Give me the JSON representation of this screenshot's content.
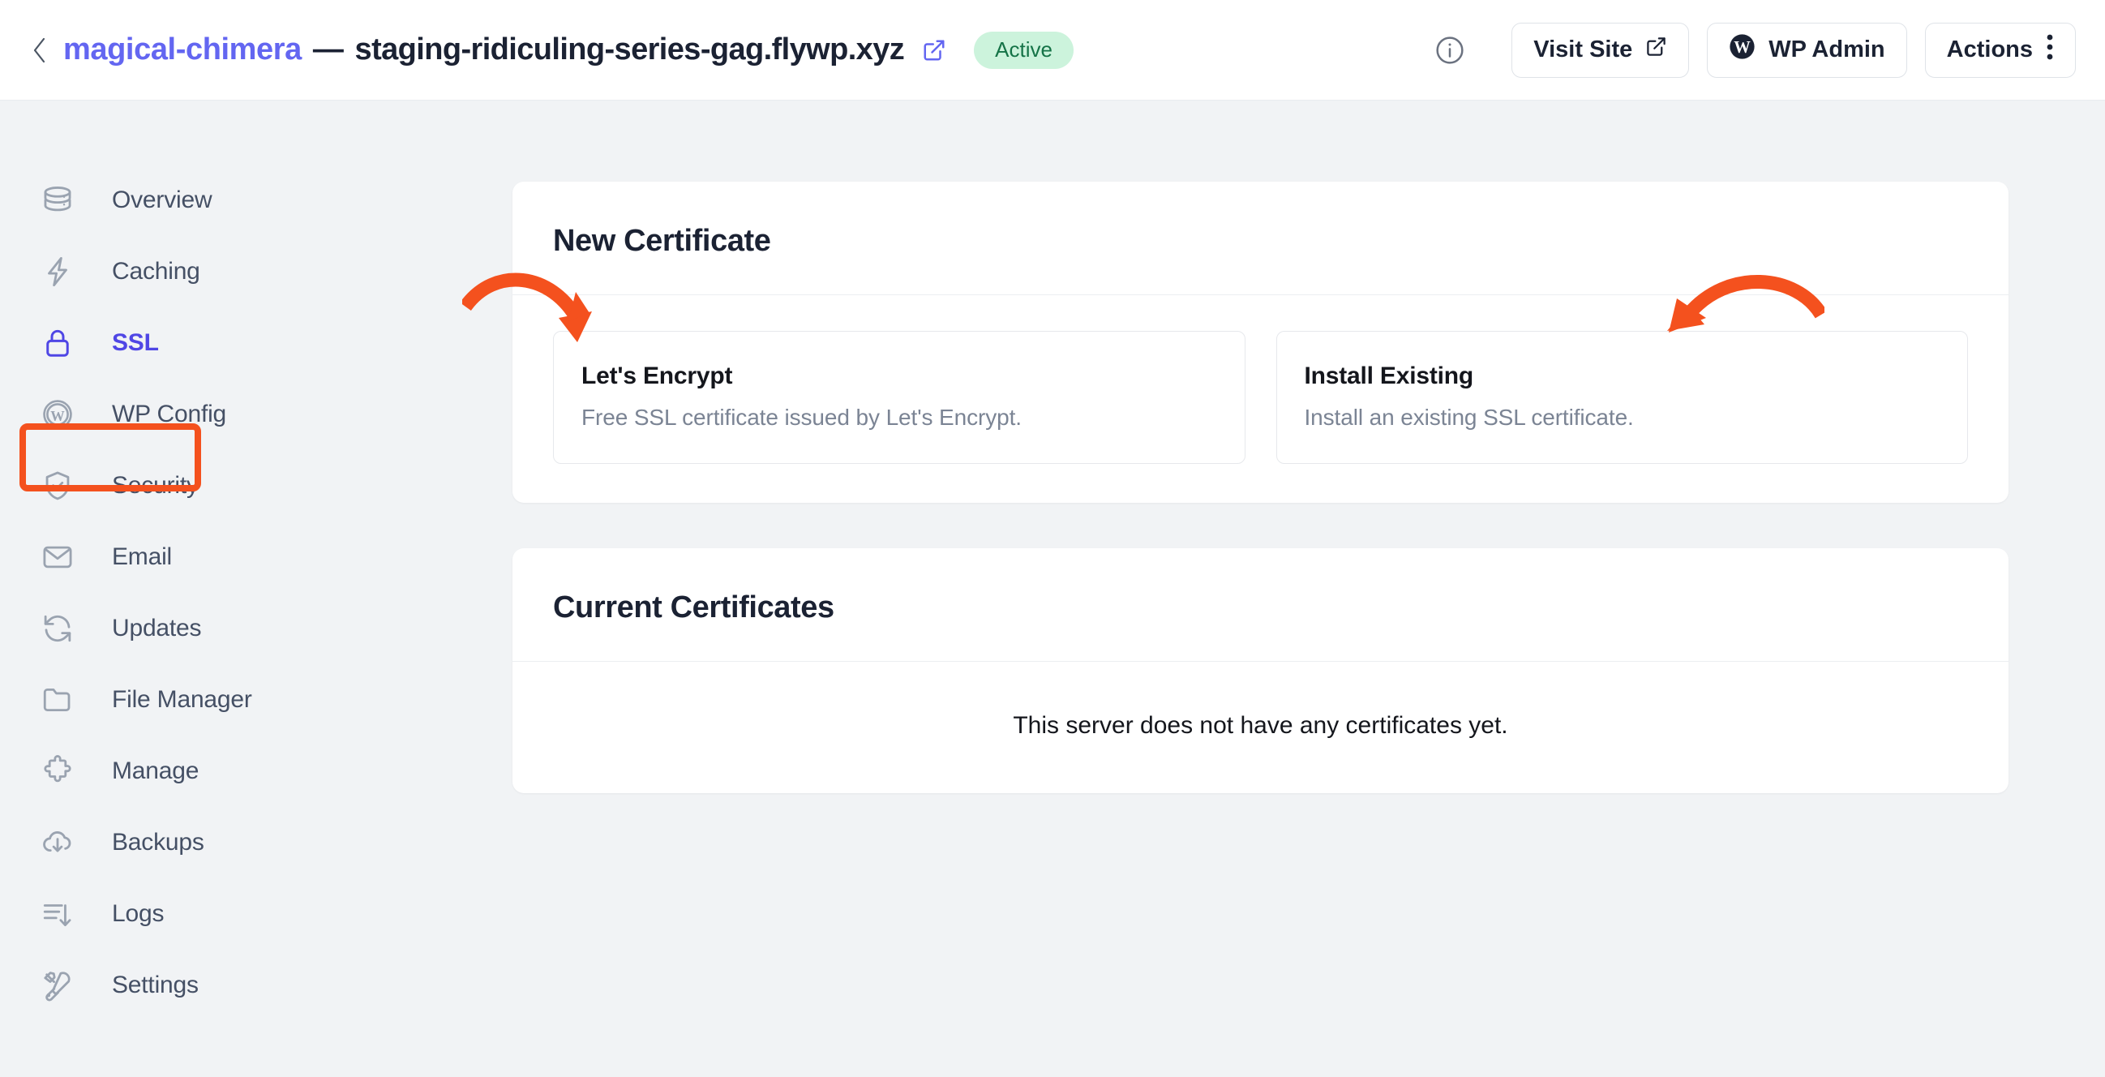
{
  "header": {
    "back_icon": "chevron-left-icon",
    "site_name": "magical-chimera",
    "separator": "—",
    "domain": "staging-ridiculing-series-gag.flywp.xyz",
    "external_link_icon": "external-link-icon",
    "status": "Active",
    "info_icon": "info-circle-icon",
    "buttons": [
      {
        "label": "Visit Site",
        "icon": "external-link-icon",
        "icon_position": "right"
      },
      {
        "label": "WP Admin",
        "icon": "wordpress-icon",
        "icon_position": "left"
      },
      {
        "label": "Actions",
        "icon": "vertical-dots-icon",
        "icon_position": "right"
      }
    ]
  },
  "sidebar": {
    "items": [
      {
        "label": "Overview",
        "icon": "server-icon",
        "active": false
      },
      {
        "label": "Caching",
        "icon": "bolt-icon",
        "active": false
      },
      {
        "label": "SSL",
        "icon": "lock-icon",
        "active": true
      },
      {
        "label": "WP Config",
        "icon": "wordpress-icon",
        "active": false
      },
      {
        "label": "Security",
        "icon": "shield-check-icon",
        "active": false
      },
      {
        "label": "Email",
        "icon": "envelope-icon",
        "active": false
      },
      {
        "label": "Updates",
        "icon": "refresh-icon",
        "active": false
      },
      {
        "label": "File Manager",
        "icon": "folder-icon",
        "active": false
      },
      {
        "label": "Manage",
        "icon": "puzzle-icon",
        "active": false
      },
      {
        "label": "Backups",
        "icon": "cloud-down-icon",
        "active": false
      },
      {
        "label": "Logs",
        "icon": "logs-icon",
        "active": false
      },
      {
        "label": "Settings",
        "icon": "tools-icon",
        "active": false
      }
    ]
  },
  "main": {
    "new_certificate": {
      "title": "New Certificate",
      "options": [
        {
          "title": "Let's Encrypt",
          "desc": "Free SSL certificate issued by Let's Encrypt."
        },
        {
          "title": "Install Existing",
          "desc": "Install an existing SSL certificate."
        }
      ]
    },
    "current_certificates": {
      "title": "Current Certificates",
      "empty_message": "This server does not have any certificates yet."
    }
  },
  "annotations": {
    "color": "#f4511e",
    "highlight_target": "SSL",
    "arrows": [
      {
        "name": "arrow-to-lets-encrypt",
        "points_to": "Let's Encrypt"
      },
      {
        "name": "arrow-to-install-existing",
        "points_to": "Install Existing"
      }
    ]
  },
  "colors": {
    "accent": "#6366f1",
    "active": "#4f46e5",
    "status_bg": "#ccf3dc",
    "status_fg": "#157347",
    "annotation": "#f4511e",
    "page_bg": "#f1f3f5"
  }
}
